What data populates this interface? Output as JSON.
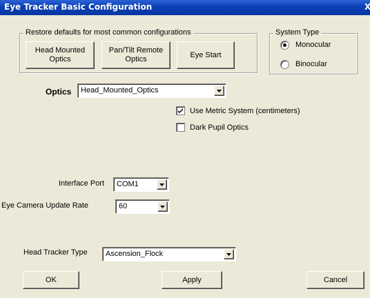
{
  "window": {
    "title": "Eye Tracker Basic Configuration",
    "close_glyph": "X"
  },
  "restore_group": {
    "legend": "Restore defaults for most common configurations",
    "buttons": [
      {
        "line1": "Head Mounted",
        "line2": "Optics"
      },
      {
        "line1": "Pan/Tilt Remote",
        "line2": "Optics"
      },
      {
        "line1": "Eye Start",
        "line2": ""
      }
    ]
  },
  "system_type": {
    "legend": "System Type",
    "options": [
      "Monocular",
      "Binocular"
    ],
    "selected": "Monocular"
  },
  "optics": {
    "label": "Optics",
    "value": "Head_Mounted_Optics"
  },
  "checkboxes": [
    {
      "label": "Use Metric System (centimeters)",
      "checked": true
    },
    {
      "label": "Dark Pupil Optics",
      "checked": false
    }
  ],
  "interface_port": {
    "label": "Interface Port",
    "value": "COM1"
  },
  "update_rate": {
    "label": "Eye Camera Update Rate",
    "value": "60"
  },
  "head_tracker": {
    "label": "Head Tracker Type",
    "value": "Ascension_Flock"
  },
  "footer": {
    "ok": "OK",
    "apply": "Apply",
    "cancel": "Cancel"
  }
}
